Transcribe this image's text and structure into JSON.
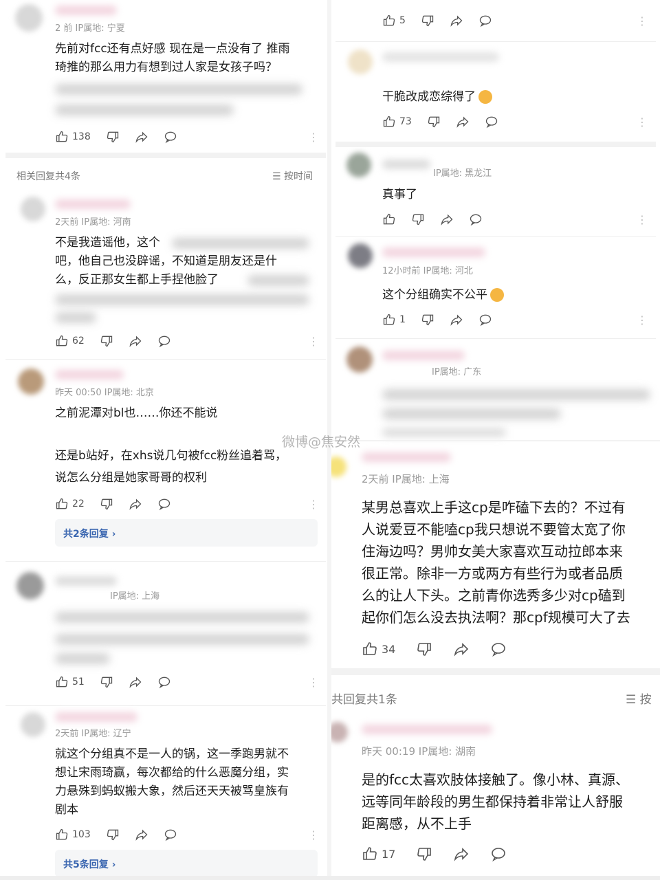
{
  "left": {
    "c1": {
      "meta": "2 前 IP属地: 宁夏",
      "lines": [
        "先前对fcc还有点好感 现在是一点没有了 推雨",
        "琦推的那么用力有想到过人家是女孩子吗？"
      ],
      "likes": "138"
    },
    "thread_header": {
      "label": "相关回复共4条",
      "sort": "按时间"
    },
    "c2": {
      "meta": "2天前 IP属地: 河南",
      "lines": [
        "不是我造谣他，这个",
        "吧，他自己也没辟谣，不知道是朋友还是什",
        "么，反正那女生都上手捏他脸了"
      ],
      "likes": "62"
    },
    "c3": {
      "meta": "昨天 00:50 IP属地: 北京",
      "lines": [
        "之前泥潭对bl也……你还不能说"
      ]
    },
    "c4": {
      "lines": [
        "还是b站好，在xhs说几句被fcc粉丝追着骂，",
        "说怎么分组是她家哥哥的权利"
      ],
      "likes": "22",
      "reply_link": "共2条回复 ›"
    },
    "c5": {
      "meta": "IP属地: 上海",
      "likes": "51"
    },
    "c6": {
      "meta": "2天前 IP属地: 辽宁",
      "lines": [
        "就这个分组真不是一人的锅，这一季跑男就不",
        "想让宋雨琦赢，每次都给的什么恶魔分组，实",
        "力悬殊到蚂蚁搬大象，然后还天天被骂皇族有",
        "剧本"
      ],
      "likes": "103",
      "reply_link": "共5条回复 ›"
    }
  },
  "right": {
    "r0": {
      "likes": "5"
    },
    "r1": {
      "lines": [
        "干脆改成恋综得了"
      ],
      "likes": "73"
    },
    "r2": {
      "meta": "IP属地: 黑龙江",
      "lines": [
        "真事了"
      ]
    },
    "r3": {
      "meta": "12小时前 IP属地: 河北",
      "lines": [
        "这个分组确实不公平"
      ],
      "likes": "1"
    },
    "r4": {
      "meta": "IP属地: 广东"
    },
    "r5": {
      "meta": "2天前 IP属地: 上海",
      "lines": [
        "某男总喜欢上手这cp是咋磕下去的？不过有",
        "人说爱豆不能嗑cp我只想说不要管太宽了你",
        "住海边吗？男帅女美大家喜欢互动拉郎本来",
        "很正常。除非一方或两方有些行为或者品质",
        "么的让人下头。之前青你选秀多少对cp磕到",
        "起你们怎么没去执法啊？那cpf规模可大了去"
      ],
      "likes": "34"
    },
    "thread_header": {
      "label": "共回复共1条",
      "sort": "按"
    },
    "r6": {
      "meta": "昨天 00:19 IP属地: 湖南",
      "lines": [
        "是的fcc太喜欢肢体接触了。像小林、真源、",
        "远等同年龄段的男生都保持着非常让人舒服",
        "距离感，从不上手"
      ],
      "likes": "17"
    }
  },
  "watermark": "微博@焦安然",
  "icons": [
    "thumb-up-icon",
    "thumb-down-icon",
    "share-icon",
    "comment-icon",
    "more-icon"
  ]
}
